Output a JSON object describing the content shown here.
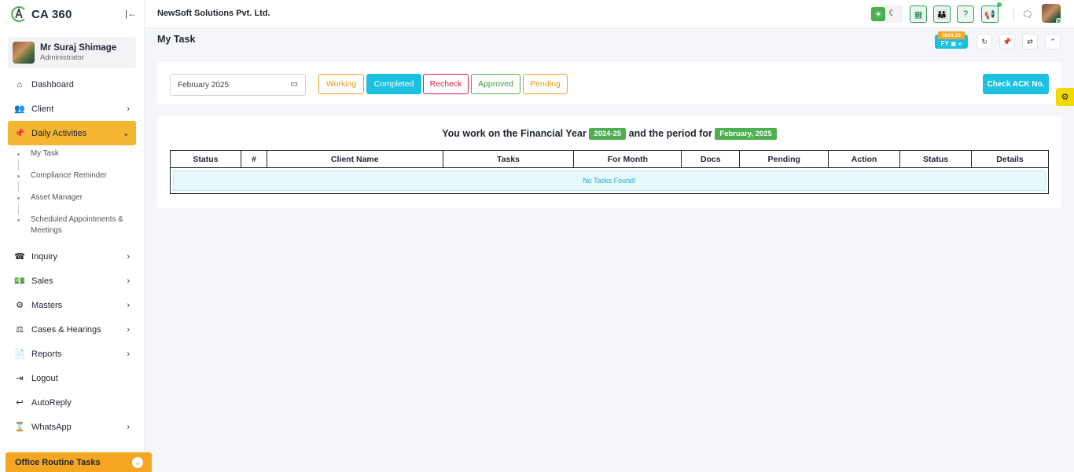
{
  "app": {
    "name": "CA 360"
  },
  "user": {
    "name": "Mr Suraj Shimage",
    "role": "Administrator"
  },
  "nav": {
    "items": [
      {
        "label": "Dashboard",
        "icon": "home-icon"
      },
      {
        "label": "Client",
        "icon": "users-icon"
      },
      {
        "label": "Daily Activities",
        "icon": "pin-icon",
        "active": true
      },
      {
        "label": "Inquiry",
        "icon": "phone-icon"
      },
      {
        "label": "Sales",
        "icon": "money-icon"
      },
      {
        "label": "Masters",
        "icon": "gears-icon"
      },
      {
        "label": "Cases & Hearings",
        "icon": "scale-icon"
      },
      {
        "label": "Reports",
        "icon": "file-icon"
      },
      {
        "label": "Logout",
        "icon": "logout-icon"
      },
      {
        "label": "AutoReply",
        "icon": "reply-icon"
      },
      {
        "label": "WhatsApp",
        "icon": "hourglass-icon"
      }
    ],
    "sub_items": [
      "My Task",
      "Compliance Reminder",
      "Asset Manager",
      "Scheduled Appointments & Meetings"
    ]
  },
  "routine": {
    "label": "Office Routine Tasks"
  },
  "header": {
    "company": "NewSoft Solutions Pvt. Ltd."
  },
  "page": {
    "title": "My Task",
    "fy_badge": "2024-25",
    "fy_button": "FY"
  },
  "filters": {
    "month_value": "February 2025",
    "buttons": [
      "Working",
      "Completed",
      "Recheck",
      "Approved",
      "Pending"
    ],
    "ack_button": "Check ACK No."
  },
  "summary": {
    "prefix": "You work on the Financial Year",
    "year": "2024-25",
    "middle": "and the period for",
    "period": "February, 2025"
  },
  "table": {
    "columns": [
      "Status",
      "#",
      "Client Name",
      "Tasks",
      "For Month",
      "Docs",
      "Pending",
      "Action",
      "Status",
      "Details"
    ],
    "empty_message": "No Tasks Found!"
  },
  "colors": {
    "accent": "#1cc0e0",
    "active_nav": "#f5b731",
    "routine": "#f5a623",
    "success": "#4caf50",
    "danger": "#e0204a"
  }
}
